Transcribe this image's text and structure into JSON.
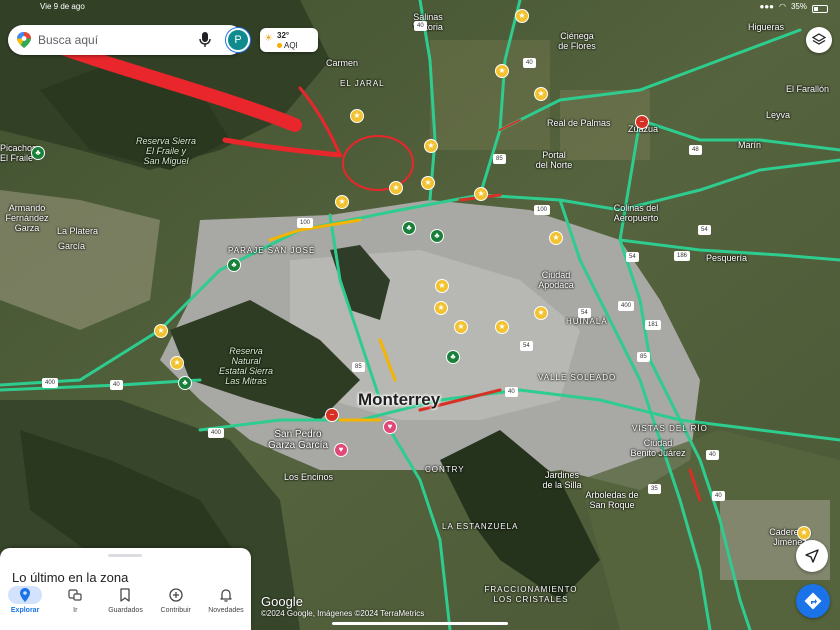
{
  "status_bar": {
    "time": "Vie 9 de ago",
    "battery": "35%"
  },
  "search": {
    "placeholder": "Busca aquí",
    "avatar_letter": "P"
  },
  "weather": {
    "temperature": "32°",
    "aqi": "AQI"
  },
  "map": {
    "city_label": "Monterrey",
    "labels": {
      "salinas_victoria": "Salinas\nVictoria",
      "cienega_de_flores": "Ciénega\nde Flores",
      "higueras": "Higueras",
      "el_farallon": "El Farallón",
      "leyva": "Leyva",
      "carmen": "Carmen",
      "el_jaral": "EL JARAL",
      "real_de_palmas": "Real de Palmas",
      "zuazua": "Zuazua",
      "portal_del_norte": "Portal\ndel Norte",
      "marin": "Marín",
      "reserva_el_fraile": "Reserva Sierra\nEl Fraile y\nSan Miguel",
      "picachos_fraile": "Picachos\nEl Fraile",
      "armando_fernandez": "Armando\nFernández\nGarza",
      "la_platera": "La Platera",
      "garcia": "García",
      "paraje_san_jose": "PARAJE SAN JOSÉ",
      "colinas_aeropuerto": "Colinas del\nAeropuerto",
      "pesqueria": "Pesquería",
      "ciudad_apodaca": "Ciudad\nApodaca",
      "huinala": "HUINALÁ",
      "reserva_las_mitras": "Reserva\nNatural\nEstatal Sierra\nLas Mitras",
      "valle_soleado": "VALLE SOLEADO",
      "vistas_del_rio": "VISTAS DEL RÍO",
      "ciudad_benito_juarez": "Ciudad\nBenito Juárez",
      "san_pedro": "San Pedro\nGarza García",
      "los_encinos": "Los Encinos",
      "contry": "CONTRY",
      "jardines_silla": "Jardines\nde la Silla",
      "arboledas_san_roque": "Arboledas de\nSan Roque",
      "la_estanzuela": "LA ESTANZUELA",
      "fraccionamiento_cristales": "FRACCIONAMIENTO\nLOS CRISTALES",
      "cadereyta": "Cadereyta\nJiménez"
    },
    "route_shields": [
      "40",
      "85",
      "100",
      "100",
      "40",
      "186",
      "54",
      "400",
      "54",
      "181",
      "400",
      "40",
      "40",
      "400",
      "85",
      "54",
      "40",
      "85",
      "35",
      "40",
      "48",
      "54"
    ]
  },
  "attribution": {
    "logo": "Google",
    "copyright": "©2024 Google, Imágenes ©2024 TerraMetrics"
  },
  "sheet": {
    "title": "Lo último en la zona"
  },
  "nav": {
    "explore": "Explorar",
    "go": "Ir",
    "saved": "Guardados",
    "contribute": "Contribuir",
    "updates": "Novedades"
  },
  "colors": {
    "highway": "#2ecc8f",
    "traffic_slow": "#f4b400",
    "traffic_heavy": "#d93025",
    "annotation": "#e8262b",
    "accent": "#1a73e8"
  }
}
